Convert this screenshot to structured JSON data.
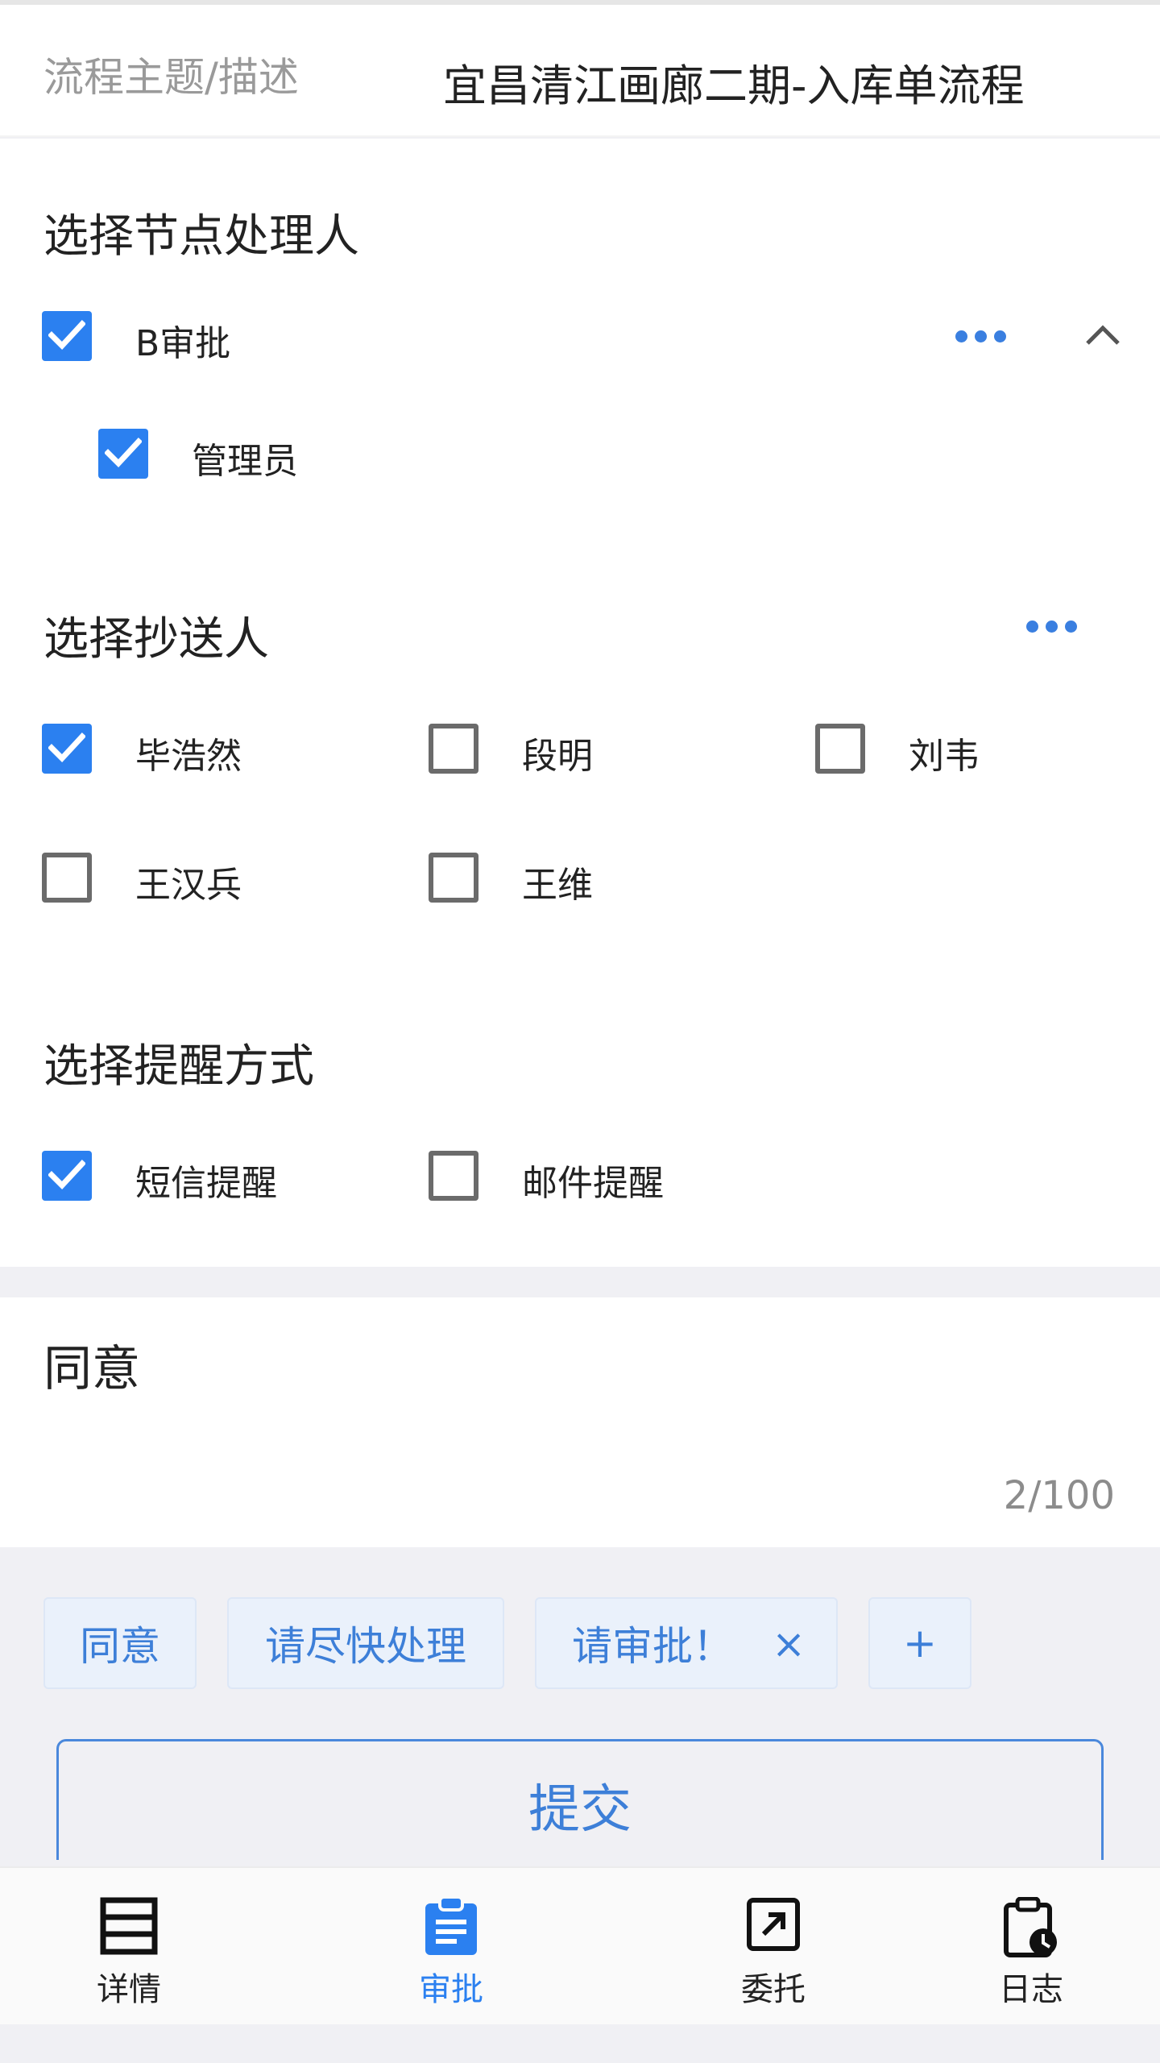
{
  "header": {
    "label": "流程主题/描述",
    "value": "宜昌清江画廊二期-入库单流程"
  },
  "node_handlers": {
    "title": "选择节点处理人",
    "group_label": "B审批",
    "group_checked": true,
    "members": [
      {
        "label": "管理员",
        "checked": true
      }
    ]
  },
  "cc": {
    "title": "选择抄送人",
    "people": [
      {
        "label": "毕浩然",
        "checked": true
      },
      {
        "label": "段明",
        "checked": false
      },
      {
        "label": "刘韦",
        "checked": false
      },
      {
        "label": "王汉兵",
        "checked": false
      },
      {
        "label": "王维",
        "checked": false
      }
    ]
  },
  "reminder": {
    "title": "选择提醒方式",
    "options": [
      {
        "label": "短信提醒",
        "checked": true
      },
      {
        "label": "邮件提醒",
        "checked": false
      }
    ]
  },
  "comment": {
    "text": "同意",
    "counter": "2/100"
  },
  "quick_phrases": [
    {
      "label": "同意"
    },
    {
      "label": "请尽快处理"
    },
    {
      "label": "请审批！",
      "removable": true
    },
    {
      "label": "+"
    }
  ],
  "remove_glyph": "×",
  "submit_label": "提交",
  "nav": [
    {
      "label": "详情",
      "icon": "list-icon",
      "active": false
    },
    {
      "label": "审批",
      "icon": "clipboard-icon",
      "active": true
    },
    {
      "label": "委托",
      "icon": "share-arrow-icon",
      "active": false
    },
    {
      "label": "日志",
      "icon": "clipboard-clock-icon",
      "active": false
    }
  ],
  "colors": {
    "accent": "#2b80f0",
    "chip_bg": "#eaf1fb",
    "chip_text": "#3d7fd8"
  }
}
